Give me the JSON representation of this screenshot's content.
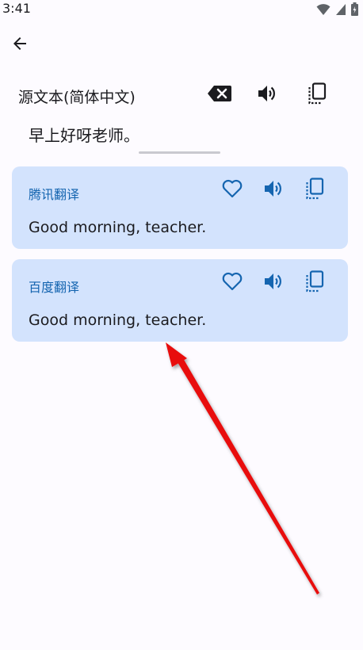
{
  "status_bar": {
    "time": "3:41",
    "icons": [
      "wifi-icon",
      "signal-icon",
      "battery-icon"
    ]
  },
  "header": {
    "back_icon": "arrow-back-icon"
  },
  "source": {
    "label": "源文本(简体中文)",
    "text": "早上好呀老师。",
    "actions": [
      "backspace-icon",
      "speaker-icon",
      "copy-icon"
    ]
  },
  "results": [
    {
      "provider": "腾讯翻译",
      "translation": "Good morning, teacher.",
      "actions": [
        "heart-icon",
        "speaker-icon",
        "copy-icon"
      ]
    },
    {
      "provider": "百度翻译",
      "translation": "Good morning, teacher.",
      "actions": [
        "heart-icon",
        "speaker-icon",
        "copy-icon"
      ]
    }
  ],
  "colors": {
    "background": "#fdfbff",
    "card": "#d3e3fd",
    "accent": "#1565b0",
    "annotation_arrow": "#e81010"
  }
}
